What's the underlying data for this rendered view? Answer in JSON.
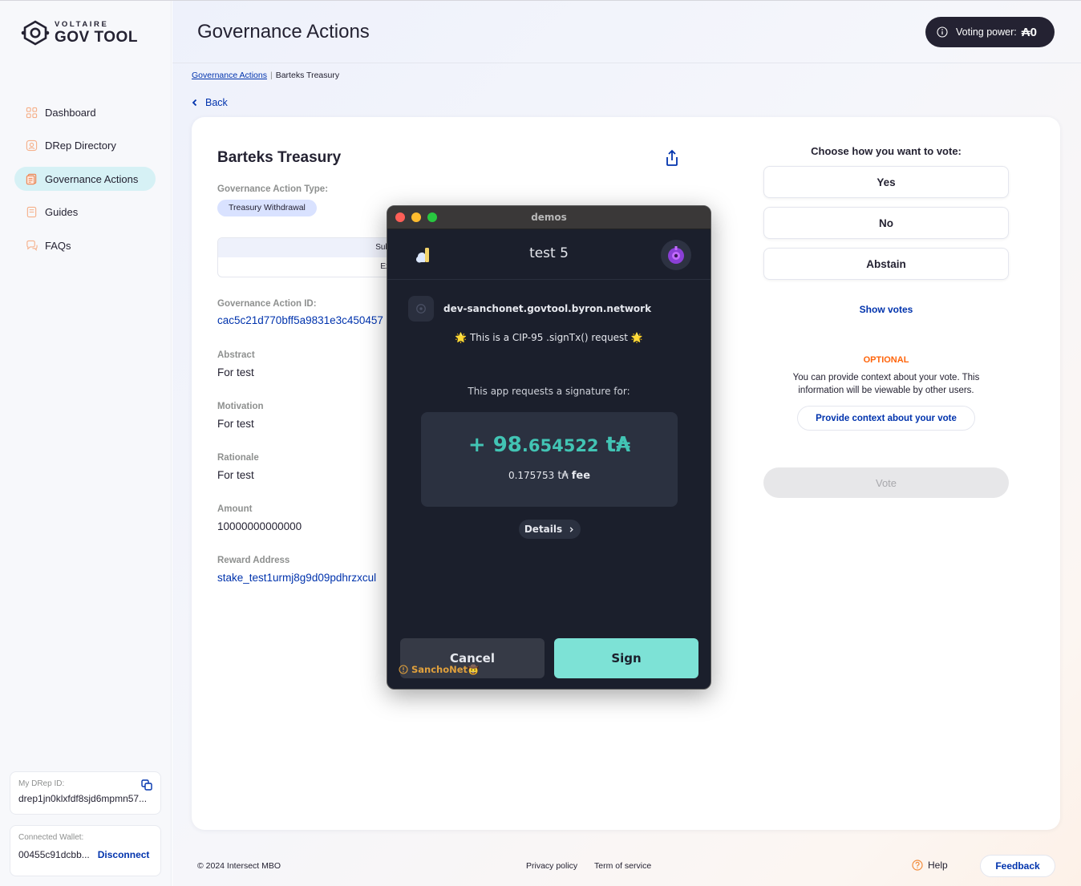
{
  "logo": {
    "top": "VOLTAIRE",
    "main": "GOV TOOL"
  },
  "sidebar": {
    "items": [
      {
        "label": "Dashboard",
        "icon": "dashboard-icon"
      },
      {
        "label": "DRep Directory",
        "icon": "drep-directory-icon"
      },
      {
        "label": "Governance Actions",
        "icon": "governance-actions-icon",
        "active": true
      },
      {
        "label": "Guides",
        "icon": "guides-icon"
      },
      {
        "label": "FAQs",
        "icon": "faqs-icon"
      }
    ],
    "drep": {
      "label": "My DRep ID:",
      "value": "drep1jn0klxfdf8sjd6mpmn57..."
    },
    "wallet": {
      "label": "Connected Wallet:",
      "value": "00455c91dcbb...",
      "disconnect": "Disconnect"
    }
  },
  "header": {
    "title": "Governance Actions",
    "voting_power_label": "Voting power:",
    "voting_power_value": "₳0"
  },
  "breadcrumb": {
    "link": "Governance Actions",
    "current": "Barteks Treasury"
  },
  "back_label": "Back",
  "action": {
    "title": "Barteks Treasury",
    "type_label": "Governance Action Type:",
    "type_value": "Treasury Withdrawal",
    "tab_row1": "Sub",
    "tab_row2": "Ex",
    "id_label": "Governance Action ID:",
    "id_value": "cac5c21d770bff5a9831e3c450457",
    "abstract_label": "Abstract",
    "abstract_value": "For test",
    "motivation_label": "Motivation",
    "motivation_value": "For test",
    "rationale_label": "Rationale",
    "rationale_value": "For test",
    "amount_label": "Amount",
    "amount_value": "10000000000000",
    "reward_label": "Reward Address",
    "reward_value": "stake_test1urmj8g9d09pdhrzxcul"
  },
  "vote": {
    "heading": "Choose how you want to vote:",
    "options": [
      "Yes",
      "No",
      "Abstain"
    ],
    "show_votes": "Show votes",
    "optional": "OPTIONAL",
    "optional_desc": "You can provide context about your vote. This information will be viewable by other users.",
    "context_button": "Provide context about your vote",
    "submit": "Vote"
  },
  "footer": {
    "copyright": "© 2024 Intersect MBO",
    "privacy": "Privacy policy",
    "terms": "Term of service",
    "help": "Help",
    "feedback": "Feedback"
  },
  "popup": {
    "window_title": "demos",
    "wallet_name": "test 5",
    "origin": "dev-sanchonet.govtool.byron.network",
    "cip_text": "🌟 This is a CIP-95 .signTx() request 🌟",
    "request_text": "This app requests a signature for:",
    "amount_prefix": "+ ",
    "amount_int": "98",
    "amount_dec": ".654522",
    "amount_unit": " t₳",
    "fee_value": "0.175753",
    "fee_unit": " t₳",
    "fee_label": "fee",
    "details": "Details",
    "cancel": "Cancel",
    "sign": "Sign",
    "network": "SanchoNet🤠"
  },
  "colors": {
    "accent": "#0033ad",
    "active_nav": "#d6f1f5",
    "popup_teal": "#7de2d6",
    "optional_orange": "#ff640a"
  }
}
